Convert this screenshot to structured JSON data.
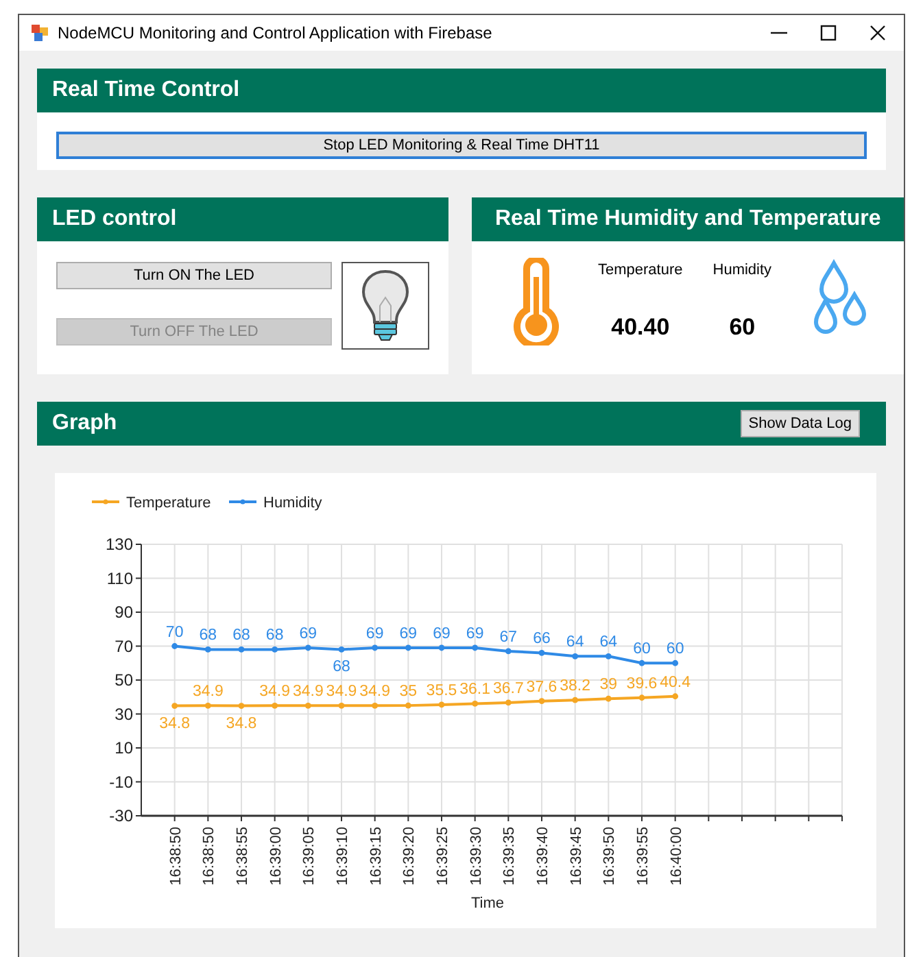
{
  "window": {
    "title": "NodeMCU Monitoring and Control Application with Firebase"
  },
  "real_time_control": {
    "title": "Real Time Control",
    "button": {
      "label": "Stop LED Monitoring & Real Time DHT11",
      "focused": true
    }
  },
  "led_control": {
    "title": "LED control",
    "buttons": [
      {
        "label": "Turn ON The LED",
        "disabled": false
      },
      {
        "label": "Turn OFF The LED",
        "disabled": true
      }
    ]
  },
  "readings": {
    "title": "Real Time Humidity and Temperature",
    "items": [
      {
        "label": "Temperature",
        "value": "40.40"
      },
      {
        "label": "Humidity",
        "value": "60"
      }
    ]
  },
  "graph": {
    "title": "Graph",
    "button": "Show Data Log",
    "chart_data": {
      "type": "line",
      "xlabel": "Time",
      "ylim": [
        -30,
        130
      ],
      "yticks": [
        -30,
        -10,
        10,
        30,
        50,
        70,
        90,
        110,
        130
      ],
      "data_labels": true,
      "grid": true,
      "legend": "top-left",
      "categories": [
        "16:38:50",
        "16:38:50",
        "16:38:55",
        "16:39:00",
        "16:39:05",
        "16:39:10",
        "16:39:15",
        "16:39:20",
        "16:39:25",
        "16:39:30",
        "16:39:35",
        "16:39:40",
        "16:39:45",
        "16:39:50",
        "16:39:55",
        "16:40:00"
      ],
      "series": [
        {
          "name": "Temperature",
          "color": "#f5a623",
          "marker": "circle",
          "values": [
            34.8,
            34.9,
            34.8,
            34.9,
            34.9,
            34.9,
            34.9,
            35,
            35.5,
            36.1,
            36.7,
            37.6,
            38.2,
            39,
            39.6,
            40.4
          ]
        },
        {
          "name": "Humidity",
          "color": "#2f8ae6",
          "marker": "circle",
          "values": [
            70,
            68,
            68,
            68,
            69,
            68,
            69,
            69,
            69,
            69,
            67,
            66,
            64,
            64,
            60,
            60
          ]
        }
      ]
    }
  }
}
